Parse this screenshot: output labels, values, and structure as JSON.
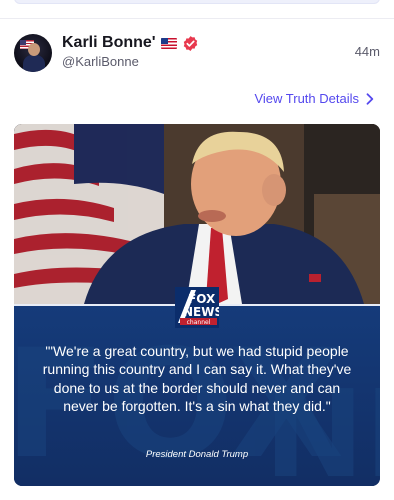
{
  "post": {
    "display_name": "Karli Bonne'",
    "handle": "@KarliBonne",
    "timestamp": "44m",
    "details_link": "View Truth Details",
    "flag_emoji": "us-flag-icon",
    "verified_icon": "verified-badge-icon",
    "verified_color": "#e8394e",
    "link_color": "#5448ee"
  },
  "media": {
    "network_logo": {
      "line1": "FOX",
      "line2": "NEWS",
      "line3": "channel"
    },
    "quote": "\"'We're a great country, but we had stupid people running this country and I can say it. What they've done to us at the border should never and can never be forgotten. It's a sin what they did.\"",
    "attribution": "President Donald Trump",
    "band_color": "#153b7a"
  }
}
